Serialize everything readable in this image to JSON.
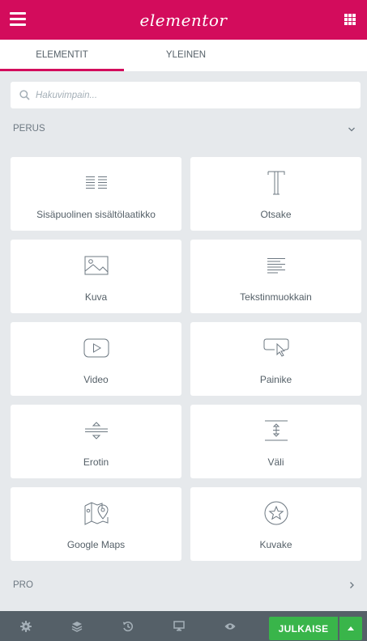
{
  "header": {
    "logo_text": "elementor",
    "brand_color": "#d30c5c"
  },
  "tabs": [
    {
      "label": "ELEMENTIT",
      "active": true
    },
    {
      "label": "YLEINEN",
      "active": false
    }
  ],
  "search": {
    "placeholder": "Hakuvimpain..."
  },
  "sections": {
    "perus": {
      "title": "PERUS",
      "expanded": true
    },
    "pro": {
      "title": "PRO",
      "expanded": false
    }
  },
  "widgets": [
    {
      "label": "Sisäpuolinen sisältölaatikko",
      "icon": "inner-section-icon"
    },
    {
      "label": "Otsake",
      "icon": "heading-icon"
    },
    {
      "label": "Kuva",
      "icon": "image-icon"
    },
    {
      "label": "Tekstinmuokkain",
      "icon": "text-editor-icon"
    },
    {
      "label": "Video",
      "icon": "video-icon"
    },
    {
      "label": "Painike",
      "icon": "button-icon"
    },
    {
      "label": "Erotin",
      "icon": "divider-icon"
    },
    {
      "label": "Väli",
      "icon": "spacer-icon"
    },
    {
      "label": "Google Maps",
      "icon": "google-maps-icon"
    },
    {
      "label": "Kuvake",
      "icon": "star-icon"
    }
  ],
  "footer": {
    "icons": [
      "settings-icon",
      "navigator-icon",
      "history-icon",
      "responsive-icon",
      "preview-icon"
    ],
    "publish_label": "JULKAISE",
    "publish_color": "#39b54a"
  }
}
